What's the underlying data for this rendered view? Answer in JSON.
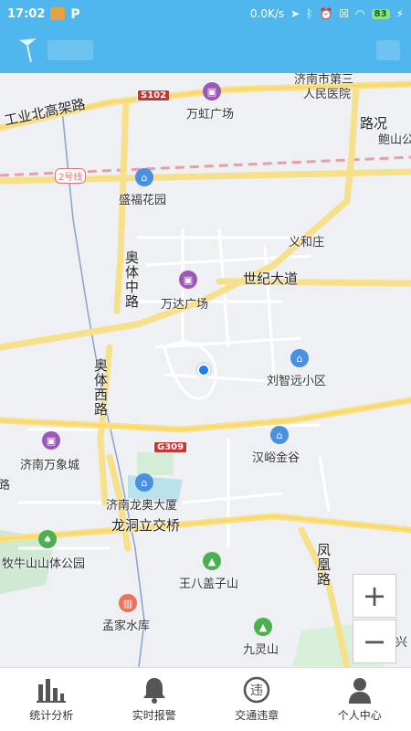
{
  "status_bar": {
    "time": "17:02",
    "network_speed": "0.0K/s",
    "battery": "83",
    "p_label": "P"
  },
  "map": {
    "labels": {
      "industrial_north_elevated": "工业北高架路",
      "s102": "S102",
      "wanhong_plaza": "万虹广场",
      "jinan_hospital_line1": "济南市第三",
      "jinan_hospital_line2": "人民医院",
      "traffic": "路况",
      "baoshan": "鲍山公",
      "metro_line2": "2号线",
      "shengfu_garden": "盛福花园",
      "yihe_village": "义和庄",
      "aoti_middle_road": "奥体中路",
      "wanda_plaza": "万达广场",
      "century_avenue": "世纪大道",
      "aoti_west_road": "奥体西路",
      "liu_zhiyuan_district": "刘智远小区",
      "g309": "G309",
      "jinan_wanxiang_city": "济南万象城",
      "hanyu_jingu": "汉峪金谷",
      "jinan_longao_building": "济南龙奥大厦",
      "longdong_interchange": "龙洞立交桥",
      "fenghuang_road": "凤凰路",
      "muniushan_park": "牧牛山山体公园",
      "wangba_gaizi_mountain": "王八盖子山",
      "mengjia_reservoir": "孟家水库",
      "jiuling_mountain": "九灵山",
      "gang_xing": "港兴",
      "left_edge_road": "路"
    },
    "zoom_in": "+",
    "zoom_out": "−"
  },
  "tabs": [
    {
      "label": "统计分析",
      "icon": "bar-chart-icon"
    },
    {
      "label": "实时报警",
      "icon": "bell-icon"
    },
    {
      "label": "交通违章",
      "icon": "violation-icon",
      "icon_text": "违"
    },
    {
      "label": "个人中心",
      "icon": "user-icon"
    }
  ]
}
